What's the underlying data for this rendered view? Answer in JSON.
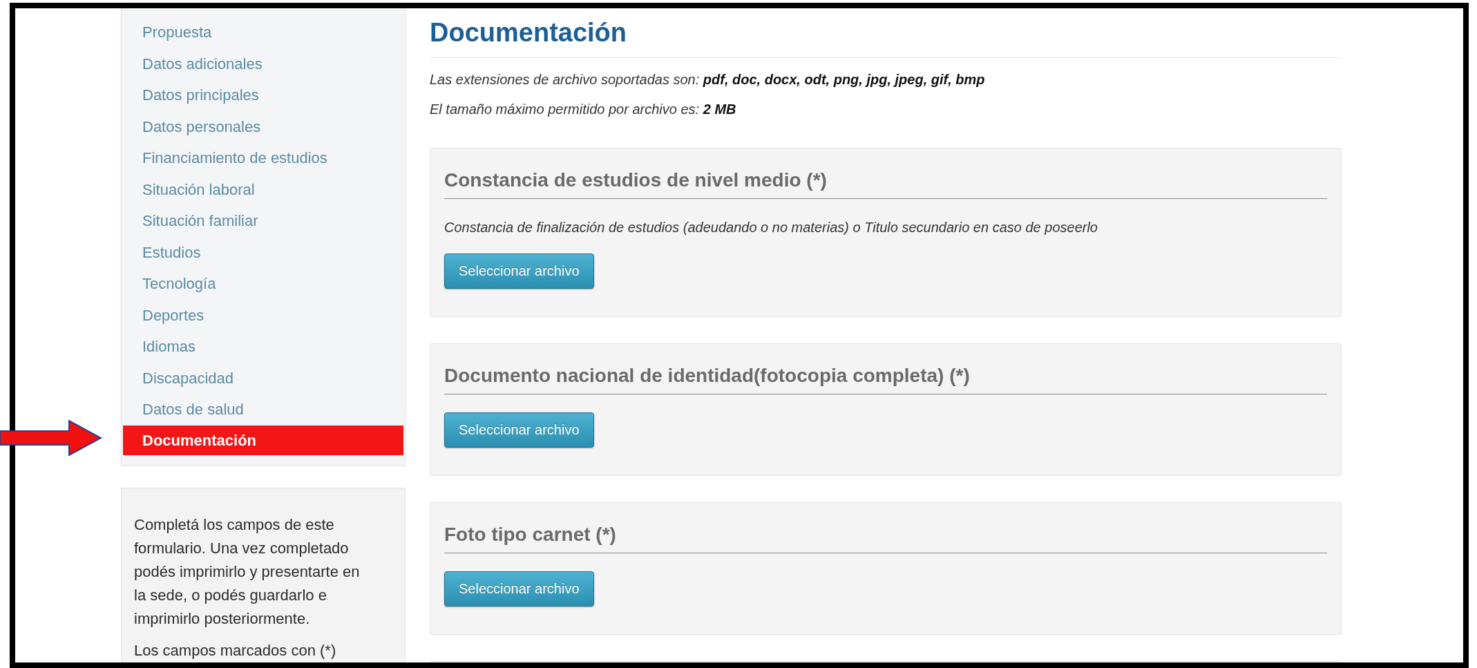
{
  "sidebar": {
    "items": [
      {
        "label": "Propuesta",
        "selected": false
      },
      {
        "label": "Datos adicionales",
        "selected": false
      },
      {
        "label": "Datos principales",
        "selected": false
      },
      {
        "label": "Datos personales",
        "selected": false
      },
      {
        "label": "Financiamiento de estudios",
        "selected": false
      },
      {
        "label": "Situación laboral",
        "selected": false
      },
      {
        "label": "Situación familiar",
        "selected": false
      },
      {
        "label": "Estudios",
        "selected": false
      },
      {
        "label": "Tecnología",
        "selected": false
      },
      {
        "label": "Deportes",
        "selected": false
      },
      {
        "label": "Idiomas",
        "selected": false
      },
      {
        "label": "Discapacidad",
        "selected": false
      },
      {
        "label": "Datos de salud",
        "selected": false
      },
      {
        "label": "Documentación",
        "selected": true
      }
    ]
  },
  "info": {
    "paragraphs": [
      "Completá los campos de este formulario. Una vez completado podés imprimirlo y presentarte en la sede, o podés guardarlo e imprimirlo posteriormente.",
      "Los campos marcados con (*)"
    ]
  },
  "main": {
    "title": "Documentación",
    "notes": [
      "Las extensiones de archivo soportadas son: **pdf, doc, docx, odt, png, jpg, jpeg, gif, bmp**",
      "El tamaño máximo permitido por archivo es: **2 MB**"
    ],
    "sections": [
      {
        "title": "Constancia de estudios de nivel medio (*)",
        "description": "Constancia de finalización de estudios (adeudando o no materias) o Titulo secundario en caso de poseerlo",
        "button": "Seleccionar archivo"
      },
      {
        "title": "Documento nacional de identidad(fotocopia completa) (*)",
        "button": "Seleccionar archivo"
      },
      {
        "title": "Foto tipo carnet (*)",
        "button": "Seleccionar archivo"
      }
    ]
  }
}
